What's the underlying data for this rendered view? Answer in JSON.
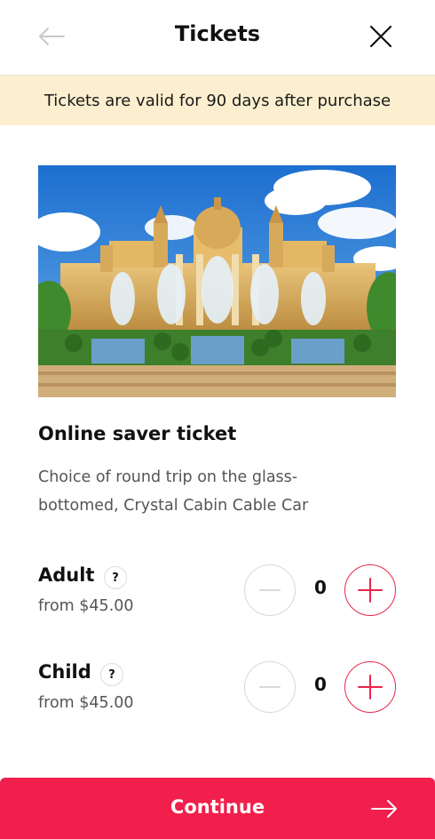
{
  "header": {
    "title": "Tickets",
    "back_icon": "arrow-left-icon",
    "close_icon": "close-icon"
  },
  "notice": {
    "text": "Tickets are valid for 90 days after purchase"
  },
  "ticket": {
    "image_icon": "palace-fountain-photo",
    "name": "Online saver ticket",
    "description": "Choice of round trip on the glass-bottomed, Crystal Cabin Cable Car"
  },
  "rows": [
    {
      "label": "Adult",
      "help": "?",
      "price": "from $45.00",
      "quantity": "0"
    },
    {
      "label": "Child",
      "help": "?",
      "price": "from $45.00",
      "quantity": "0"
    }
  ],
  "footer": {
    "continue_label": "Continue",
    "arrow_icon": "arrow-right-icon"
  },
  "colors": {
    "accent": "#f01f4b",
    "notice_bg": "#fcefcf"
  }
}
